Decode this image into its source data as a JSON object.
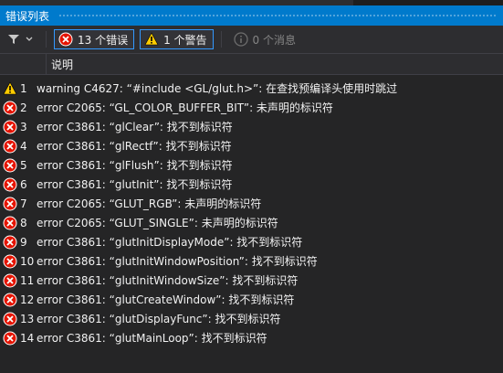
{
  "window": {
    "title": "错误列表"
  },
  "toolbar": {
    "errors_label": "13 个错误",
    "warnings_label": "1 个警告",
    "messages_label": "0 个消息"
  },
  "colors": {
    "accent": "#007acc",
    "error": "#e51400",
    "warning": "#ffcc00"
  },
  "header": {
    "description": "说明"
  },
  "items": [
    {
      "type": "warning",
      "index": "1",
      "text": "warning C4627:  “#include <GL/glut.h>”:  在查找预编译头使用时跳过"
    },
    {
      "type": "error",
      "index": "2",
      "text": "error C2065:  “GL_COLOR_BUFFER_BIT”: 未声明的标识符"
    },
    {
      "type": "error",
      "index": "3",
      "text": "error C3861:  “glClear”:  找不到标识符"
    },
    {
      "type": "error",
      "index": "4",
      "text": "error C3861:  “glRectf”:  找不到标识符"
    },
    {
      "type": "error",
      "index": "5",
      "text": "error C3861:  “glFlush”:  找不到标识符"
    },
    {
      "type": "error",
      "index": "6",
      "text": "error C3861:  “glutInit”:  找不到标识符"
    },
    {
      "type": "error",
      "index": "7",
      "text": "error C2065:  “GLUT_RGB”: 未声明的标识符"
    },
    {
      "type": "error",
      "index": "8",
      "text": "error C2065:  “GLUT_SINGLE”: 未声明的标识符"
    },
    {
      "type": "error",
      "index": "9",
      "text": "error C3861:  “glutInitDisplayMode”:  找不到标识符"
    },
    {
      "type": "error",
      "index": "10",
      "text": "error C3861:  “glutInitWindowPosition”:  找不到标识符"
    },
    {
      "type": "error",
      "index": "11",
      "text": "error C3861:  “glutInitWindowSize”:  找不到标识符"
    },
    {
      "type": "error",
      "index": "12",
      "text": "error C3861:  “glutCreateWindow”:  找不到标识符"
    },
    {
      "type": "error",
      "index": "13",
      "text": "error C3861:  “glutDisplayFunc”:  找不到标识符"
    },
    {
      "type": "error",
      "index": "14",
      "text": "error C3861:  “glutMainLoop”:  找不到标识符"
    }
  ]
}
